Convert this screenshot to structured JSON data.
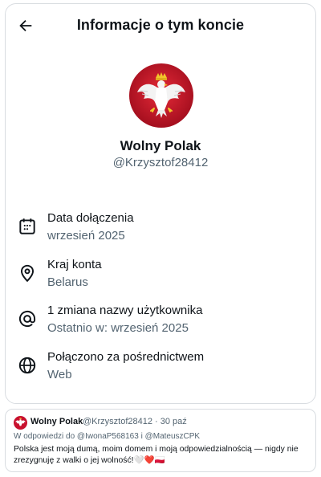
{
  "header": {
    "title": "Informacje o tym koncie"
  },
  "profile": {
    "display_name": "Wolny Polak",
    "handle": "@Krzysztof28412"
  },
  "info_rows": [
    {
      "icon": "calendar-icon",
      "label": "Data dołączenia",
      "value": "wrzesień 2025"
    },
    {
      "icon": "location-pin-icon",
      "label": "Kraj konta",
      "value": "Belarus"
    },
    {
      "icon": "at-sign-icon",
      "label": "1 zmiana nazwy użytkownika",
      "value": "Ostatnio w: wrzesień 2025"
    },
    {
      "icon": "globe-icon",
      "label": "Połączono za pośrednictwem",
      "value": "Web"
    }
  ],
  "tweet": {
    "name": "Wolny Polak",
    "handle_time": "@Krzysztof28412 · 30 paź",
    "reply_to": "W odpowiedzi do @IwonaP568163 i @MateuszCPK",
    "text": "Polska jest moją dumą, moim domem i moją odpowiedzialnością — nigdy nie zrezygnuję z walki o jej wolność!",
    "emoji_tail": "🤍❤️🇵🇱"
  },
  "colors": {
    "primary_text": "#0f1419",
    "secondary_text": "#536471",
    "border": "#d9dde1",
    "avatar_red": "#c8102e"
  }
}
